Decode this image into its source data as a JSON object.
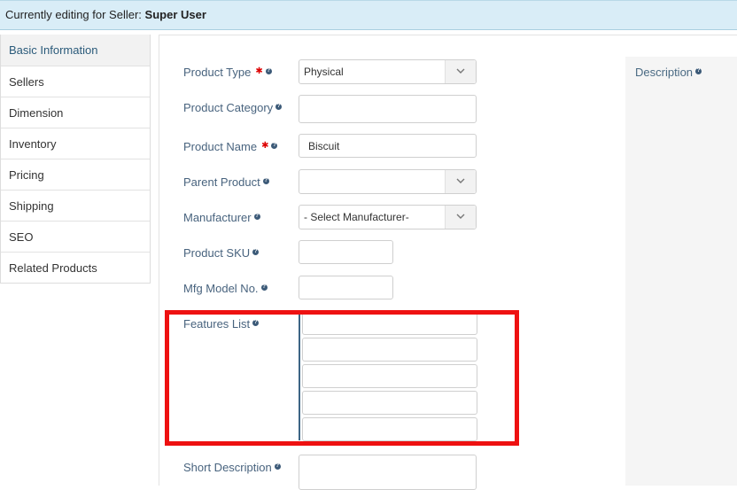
{
  "topbar": {
    "prefix": "Currently editing for Seller:",
    "seller": "Super User"
  },
  "sidebar": {
    "items": [
      {
        "label": "Basic Information"
      },
      {
        "label": "Sellers"
      },
      {
        "label": "Dimension"
      },
      {
        "label": "Inventory"
      },
      {
        "label": "Pricing"
      },
      {
        "label": "Shipping"
      },
      {
        "label": "SEO"
      },
      {
        "label": "Related Products"
      }
    ]
  },
  "form": {
    "product_type": {
      "label": "Product Type",
      "value": "Physical"
    },
    "product_category": {
      "label": "Product Category",
      "value": ""
    },
    "product_name": {
      "label": "Product Name",
      "value": "Biscuit"
    },
    "parent_product": {
      "label": "Parent Product",
      "value": ""
    },
    "manufacturer": {
      "label": "Manufacturer",
      "value": "- Select Manufacturer-"
    },
    "product_sku": {
      "label": "Product SKU",
      "value": ""
    },
    "mfg_model_no": {
      "label": "Mfg Model No.",
      "value": ""
    },
    "features_list": {
      "label": "Features List",
      "values": [
        "",
        "",
        "",
        "",
        ""
      ]
    },
    "short_description": {
      "label": "Short Description",
      "value": ""
    },
    "description": {
      "label": "Description"
    }
  },
  "icons": {
    "required": "asterisk",
    "help": "question-circle-icon",
    "dropdown": "chevron-down-icon"
  },
  "colors": {
    "topbar_bg": "#d9edf7",
    "label": "#48637e",
    "required": "#dd0000",
    "highlight": "#ee1111"
  }
}
